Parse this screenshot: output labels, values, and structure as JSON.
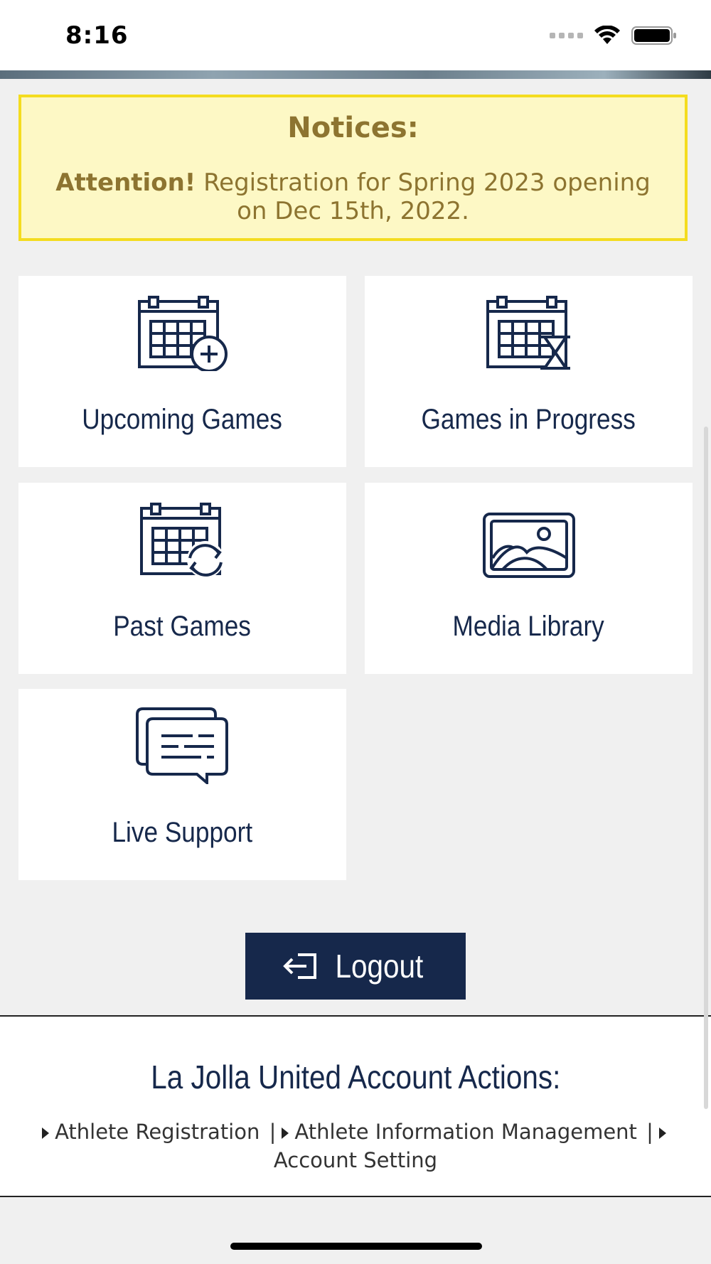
{
  "status": {
    "time": "8:16"
  },
  "notice": {
    "title": "Notices:",
    "attention": "Attention!",
    "message": " Registration for Spring 2023 opening on Dec 15th, 2022."
  },
  "tiles": [
    {
      "label": "Upcoming Games",
      "icon": "calendar-plus-icon"
    },
    {
      "label": "Games in Progress",
      "icon": "calendar-hourglass-icon"
    },
    {
      "label": "Past Games",
      "icon": "calendar-refresh-icon"
    },
    {
      "label": "Media Library",
      "icon": "image-icon"
    },
    {
      "label": "Live Support",
      "icon": "chat-icon"
    }
  ],
  "logout": {
    "label": "Logout",
    "icon": "logout-icon"
  },
  "footer": {
    "title": "La Jolla United Account Actions:",
    "links": [
      "Athlete Registration",
      "Athlete Information Management",
      "Account Setting"
    ],
    "separator": "|"
  },
  "colors": {
    "navy": "#16284b",
    "notice_bg": "#fdf8c5",
    "notice_border": "#f4dc1f",
    "notice_text": "#8d7430"
  }
}
